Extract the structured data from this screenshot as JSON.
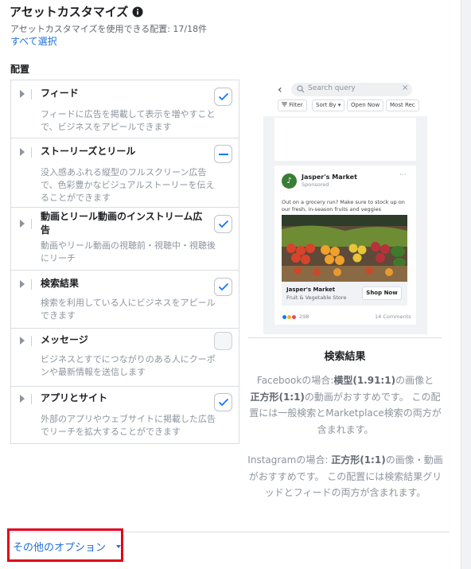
{
  "header": {
    "title": "アセットカスタマイズ",
    "subtitle": "アセットカスタマイズを使用できる配置: 17/18件",
    "select_all": "すべて選択"
  },
  "placements_label": "配置",
  "placements": [
    {
      "title": "フィード",
      "desc": "フィードに広告を掲載して表示を増やすことで、ビジネスをアピールできます",
      "state": "checked"
    },
    {
      "title": "ストーリーズとリール",
      "desc": "没入感あふれる縦型のフルスクリーン広告で、色彩豊かなビジュアルストーリーを伝えることができます",
      "state": "indeterminate"
    },
    {
      "title": "動画とリール動画のインストリーム広告",
      "desc": "動画やリール動画の視聴前・視聴中・視聴後にリーチ",
      "state": "checked"
    },
    {
      "title": "検索結果",
      "desc": "検索を利用している人にビジネスをアピールできます",
      "state": "checked"
    },
    {
      "title": "メッセージ",
      "desc": "ビジネスとすでにつながりのある人にクーポンや最新情報を送信します",
      "state": "unchecked"
    },
    {
      "title": "アプリとサイト",
      "desc": "外部のアプリやウェブサイトに掲載した広告でリーチを拡大することができます",
      "state": "checked"
    }
  ],
  "preview": {
    "search_placeholder": "Search query",
    "chips": [
      "Filter",
      "Sort By",
      "Open Now",
      "Most Rec"
    ],
    "ad": {
      "brand": "Jasper's Market",
      "sponsored": "Sponsored",
      "text": "Out on a grocery run? Make sure to stock up on our fresh, in-season fruits and veggies",
      "cta_title": "Jasper's Market",
      "cta_subtitle": "Fruit & Vegetable Store",
      "cta_button": "Shop Now",
      "reaction_count": "298",
      "comments": "14 Comments"
    },
    "title": "検索結果",
    "facebook_note": {
      "prefix": "Facebookの場合:",
      "b1": "横型(1.91:1)",
      "mid": "の画像と",
      "b2": "正方形(1:1)",
      "suffix": "の動画がおすすめです。 この配置には一般検索とMarketplace検索の両方が含まれます。"
    },
    "instagram_note": {
      "prefix": "Instagramの場合: ",
      "b1": "正方形(1:1)",
      "suffix": "の画像・動画がおすすめです。 この配置には検索結果グリッドとフィードの両方が含まれます。"
    }
  },
  "other_options": "その他のオプション",
  "colors": {
    "link": "#216fdb",
    "check": "#1877f2",
    "highlight": "#e0001b"
  }
}
